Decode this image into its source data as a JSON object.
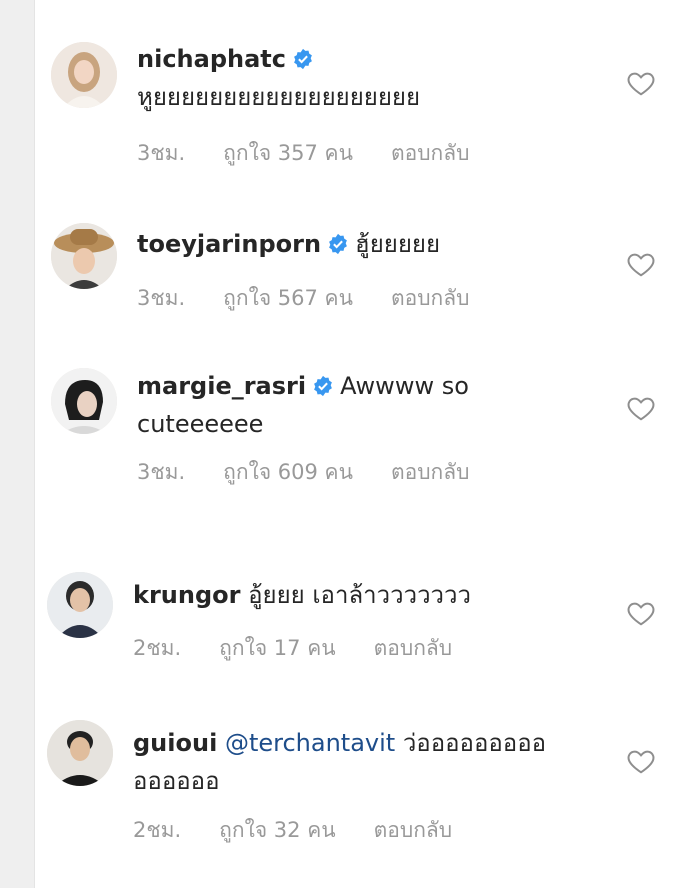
{
  "accent_color": "#3897f0",
  "comments": [
    {
      "username": "nichaphatc",
      "verified": true,
      "mention": "",
      "text": "หูยยยยยยยยยยยยยยยยยยย",
      "text_line2": "",
      "time": "3ชม.",
      "likes": "ถูกใจ 357 คน",
      "reply": "ตอบกลับ"
    },
    {
      "username": "toeyjarinporn",
      "verified": true,
      "mention": "",
      "text": "ฮู้ยยยยย",
      "text_line2": "",
      "time": "3ชม.",
      "likes": "ถูกใจ 567 คน",
      "reply": "ตอบกลับ"
    },
    {
      "username": "margie_rasri",
      "verified": true,
      "mention": "",
      "text": "Awwww so",
      "text_line2": "cuteeeeee",
      "time": "3ชม.",
      "likes": "ถูกใจ 609 คน",
      "reply": "ตอบกลับ"
    },
    {
      "username": "krungor",
      "verified": false,
      "mention": "",
      "text": "อู้ยยย เอาล้าววววววว",
      "text_line2": "",
      "time": "2ชม.",
      "likes": "ถูกใจ 17 คน",
      "reply": "ตอบกลับ"
    },
    {
      "username": "guioui",
      "verified": false,
      "mention": "@terchantavit",
      "text": "ว่อออออออออ",
      "text_line2": "ออออออ",
      "time": "2ชม.",
      "likes": "ถูกใจ 32 คน",
      "reply": "ตอบกลับ"
    }
  ]
}
